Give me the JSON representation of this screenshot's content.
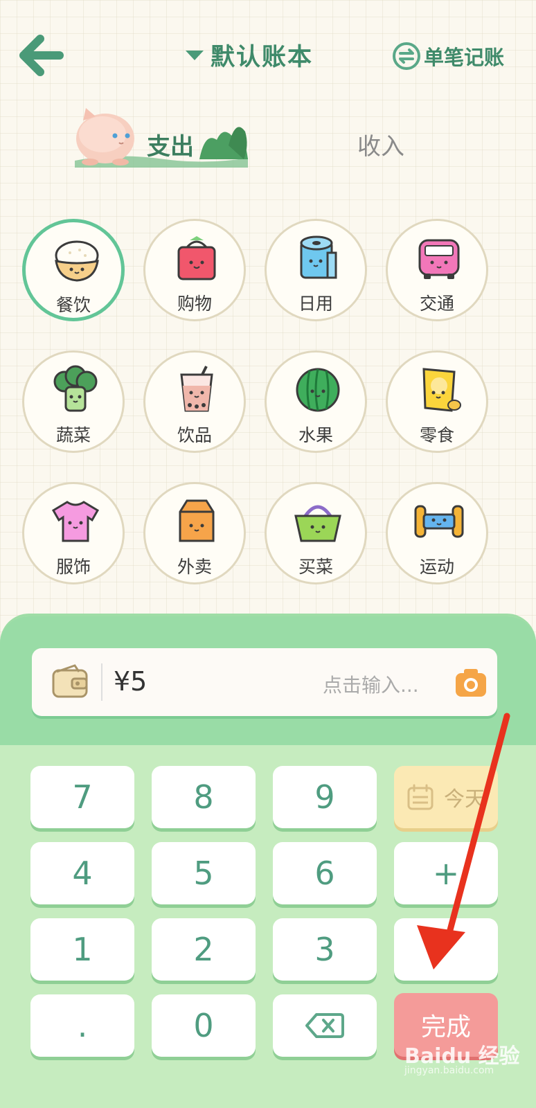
{
  "header": {
    "book_title": "默认账本",
    "single_entry_label": "单笔记账"
  },
  "tabs": {
    "expense_label": "支出",
    "income_label": "收入",
    "active": "expense"
  },
  "categories": [
    {
      "label": "餐饮",
      "icon": "rice-bowl-icon",
      "selected": true
    },
    {
      "label": "购物",
      "icon": "shopping-bag-icon",
      "selected": false
    },
    {
      "label": "日用",
      "icon": "toilet-paper-icon",
      "selected": false
    },
    {
      "label": "交通",
      "icon": "bus-icon",
      "selected": false
    },
    {
      "label": "蔬菜",
      "icon": "broccoli-icon",
      "selected": false
    },
    {
      "label": "饮品",
      "icon": "bubble-tea-icon",
      "selected": false
    },
    {
      "label": "水果",
      "icon": "watermelon-icon",
      "selected": false
    },
    {
      "label": "零食",
      "icon": "chips-icon",
      "selected": false
    },
    {
      "label": "服饰",
      "icon": "tshirt-icon",
      "selected": false
    },
    {
      "label": "外卖",
      "icon": "takeout-box-icon",
      "selected": false
    },
    {
      "label": "买菜",
      "icon": "basket-icon",
      "selected": false
    },
    {
      "label": "运动",
      "icon": "dumbbell-icon",
      "selected": false
    }
  ],
  "entry": {
    "amount": "¥5",
    "note_placeholder": "点击输入..."
  },
  "keypad": {
    "keys": [
      "7",
      "8",
      "9",
      "4",
      "5",
      "6",
      "1",
      "2",
      "3",
      ".",
      "0"
    ],
    "date_label": "今天",
    "plus_label": "+",
    "done_label": "完成"
  },
  "watermark": {
    "brand": "Baidu 经验",
    "url": "jingyan.baidu.com"
  },
  "colors": {
    "accent_green": "#3f8a6a",
    "selected_ring": "#62c597",
    "panel_green": "#c6ecbf",
    "done_red": "#f49b99",
    "arrow_red": "#e8321e"
  }
}
